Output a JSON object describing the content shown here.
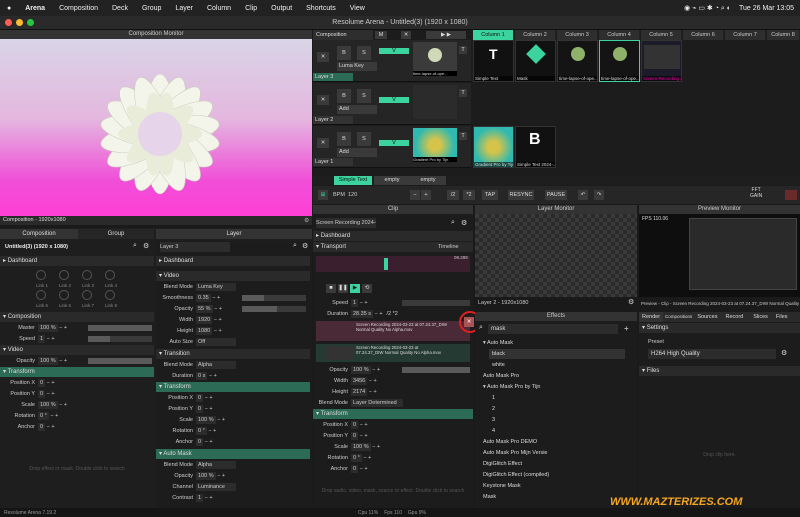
{
  "menubar": {
    "apple": "",
    "app": "Arena",
    "items": [
      "Composition",
      "Deck",
      "Group",
      "Layer",
      "Column",
      "Clip",
      "Output",
      "Shortcuts",
      "View"
    ],
    "clock": "Tue 26 Mar  13:05"
  },
  "window": {
    "title": "Resolume Arena - Untitled(3) (1920 x 1080)"
  },
  "comp_monitor": {
    "title": "Composition Monitor",
    "label": "Composition - 1920x1080"
  },
  "deck": {
    "composition_label": "Composition",
    "columns": [
      "Column 1",
      "Column 2",
      "Column 3",
      "Column 4",
      "Column 5",
      "Column 6",
      "Column 7",
      "Column 8"
    ],
    "layers": [
      {
        "name": "Layer 3",
        "blend": "Luma Key",
        "clips": [
          "Simple Text",
          "Mask",
          "time-lapse-of-ope...",
          "time-lapse-of-ope...",
          "Screen Recording 2024-03-23..."
        ],
        "strip_clip": "time-lapse-of-ope..."
      },
      {
        "name": "Layer 2",
        "blend": "Add",
        "clips": [],
        "strip_clip": ""
      },
      {
        "name": "Layer 1",
        "blend": "Add",
        "clips": [
          "Gradient Pro by Tijn",
          "Simple Text 2024-..."
        ],
        "strip_clip": "Gradient Pro by Tijn"
      }
    ],
    "deck_tabs": [
      "Simple Text",
      "empty",
      "empty"
    ]
  },
  "transport": {
    "bpm_label": "BPM",
    "bpm": "120",
    "div2": "/2",
    "mul2": "*2",
    "tap": "TAP",
    "resync": "RESYNC",
    "pause": "PAUSE",
    "fft": "FFT",
    "gain": "GAIN"
  },
  "comp_panel": {
    "tabs": [
      "Composition",
      "Group",
      "Layer"
    ],
    "name": "Untitled(3) (1920 x 1080)",
    "dashboard": "Dashboard",
    "links": [
      "Link 1",
      "Link 2",
      "Link 3",
      "Link 4",
      "Link 5",
      "Link 6",
      "Link 7",
      "Link 8"
    ],
    "composition": "Composition",
    "master": "Master",
    "master_val": "100 %",
    "speed": "Speed",
    "speed_val": "1",
    "video": "Video",
    "opacity": "Opacity",
    "opacity_val": "100 %",
    "transform": "Transform",
    "posx": "Position X",
    "posx_val": "0",
    "posy": "Position Y",
    "posy_val": "0",
    "scale": "Scale",
    "scale_val": "100 %",
    "rotation": "Rotation",
    "rotation_val": "0 °",
    "anchor": "Anchor",
    "anchor_val": "0",
    "drop_hint": "Drop effect or mask. Double click to search"
  },
  "layer_panel": {
    "name": "Layer 3",
    "dashboard": "Dashboard",
    "video": "Video",
    "blend_mode": "Blend Mode",
    "blend_val": "Luma Key",
    "smoothness": "Smoothness",
    "smooth_val": "0.35",
    "opacity": "Opacity",
    "opacity_val": "55 %",
    "width": "Width",
    "width_val": "1920",
    "height": "Height",
    "height_val": "1080",
    "autosize": "Auto Size",
    "autosize_val": "Off",
    "transition": "Transition",
    "tblend": "Blend Mode",
    "tblend_val": "Alpha",
    "duration": "Duration",
    "duration_val": "0 s",
    "transform": "Transform",
    "posx": "Position X",
    "posy": "Position Y",
    "zero": "0",
    "scale": "Scale",
    "scale_val": "100 %",
    "rotation": "Rotation",
    "rotation_val": "0 °",
    "anchor": "Anchor",
    "anchor_val": "0",
    "automask": "Auto Mask",
    "am_blend": "Blend Mode",
    "am_blend_val": "Alpha",
    "am_opacity": "Opacity",
    "am_opacity_val": "100 %",
    "channel": "Channel",
    "channel_val": "Luminance",
    "contrast": "Contrast",
    "contrast_val": "1"
  },
  "clip_panel": {
    "title": "Clip",
    "name": "Screen Recording 2024-03-...",
    "dashboard": "Dashboard",
    "transport": "Transport",
    "timeline": "Timeline",
    "time": "09.289",
    "speed": "Speed",
    "speed_val": "1",
    "duration": "Duration",
    "duration_val": "28.35 s",
    "div2": "/2",
    "mul2": "*2",
    "mask_text": "Screen Recording 2024-03-23 at 07.24.37_DIW Normal Quality No Alpha.mov",
    "source_text": "Screen Recording 2024-03-23 at 07.24.37_DIW Normal Quality No Alpha.mov",
    "opacity": "Opacity",
    "opacity_val": "100 %",
    "width": "Width",
    "width_val": "3456",
    "height": "Height",
    "height_val": "2174",
    "blend": "Blend Mode",
    "blend_val": "Layer Determined",
    "transform": "Transform",
    "posx": "Position X",
    "posy": "Position Y",
    "zero": "0",
    "scale": "Scale",
    "scale_val": "100 %",
    "rotation": "Rotation",
    "rotation_val": "0 °",
    "anchor": "Anchor",
    "anchor_val": "0",
    "hint": "Drop audio, video, mask, source or effect. Double click to search"
  },
  "layer_monitor": {
    "title": "Layer Monitor",
    "label": "Layer 2 - 1920x1080"
  },
  "effects": {
    "title": "Effects",
    "search": "mask",
    "items": [
      {
        "t": "Auto Mask",
        "k": "h"
      },
      {
        "t": "black",
        "k": "s"
      },
      {
        "t": "white",
        "k": "c"
      },
      {
        "t": "Auto Mask Pro",
        "k": "i"
      },
      {
        "t": "Auto Mask Pro by Tijn",
        "k": "h"
      },
      {
        "t": "1",
        "k": "c"
      },
      {
        "t": "2",
        "k": "c"
      },
      {
        "t": "3",
        "k": "c"
      },
      {
        "t": "4",
        "k": "c"
      },
      {
        "t": "Auto Mask Pro DEMO",
        "k": "i"
      },
      {
        "t": "Auto Mask Pro  Mijn Versie",
        "k": "i"
      },
      {
        "t": "DigiGlitch Effect",
        "k": "i"
      },
      {
        "t": "DigiGlitch Effect (compiled)",
        "k": "i"
      },
      {
        "t": "Keystone Mask",
        "k": "i"
      },
      {
        "t": "Mask",
        "k": "i"
      }
    ]
  },
  "preview": {
    "title": "Preview Monitor",
    "fps": "FPS 110.06",
    "label": "Preview - Clip - Screen Recording 2024-03-23 at 07.24.37_DIW Normal Quality No Alph..."
  },
  "render": {
    "tabs": [
      "Render",
      "Compositions",
      "Sources",
      "Record",
      "Slices",
      "Files"
    ],
    "settings": "Settings",
    "preset": "Preset",
    "preset_val": "H264 High Quality",
    "files": "Files",
    "hint": "Drop clip here."
  },
  "status": {
    "version": "Resolume Arena 7.19.2",
    "cpu": "Cpu 11%",
    "fps": "Fps 110",
    "gpu": "Gpu 9%"
  },
  "watermark": "WWW.MAZTERIZES.COM"
}
